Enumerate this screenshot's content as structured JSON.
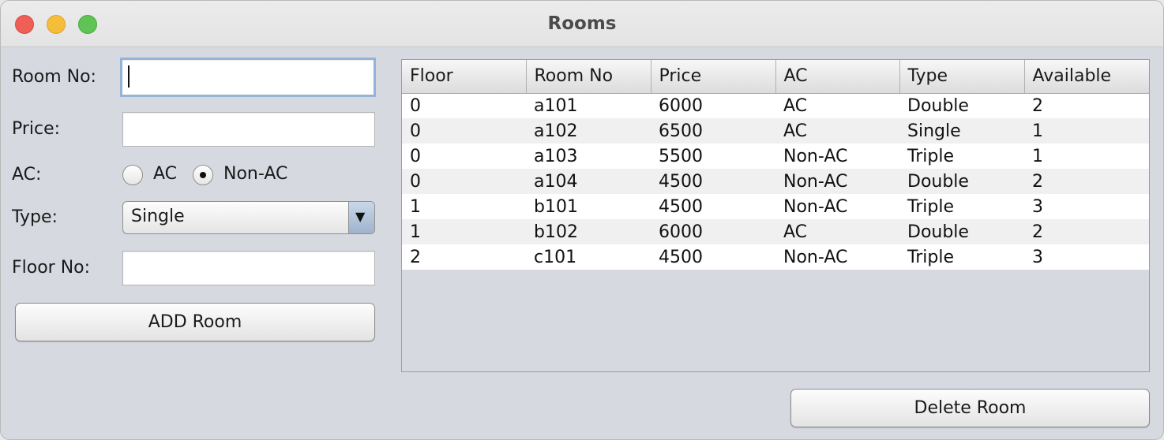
{
  "window": {
    "title": "Rooms"
  },
  "form": {
    "room_no_label": "Room No:",
    "room_no_value": "",
    "price_label": "Price:",
    "price_value": "",
    "ac_label": "AC:",
    "ac_options": [
      "AC",
      "Non-AC"
    ],
    "ac_selected": "Non-AC",
    "type_label": "Type:",
    "type_selected": "Single",
    "floor_label": "Floor No:",
    "floor_value": "",
    "add_button": "ADD Room"
  },
  "table": {
    "columns": [
      "Floor",
      "Room No",
      "Price",
      "AC",
      "Type",
      "Available"
    ],
    "rows": [
      [
        "0",
        "a101",
        "6000",
        "AC",
        "Double",
        "2"
      ],
      [
        "0",
        "a102",
        "6500",
        "AC",
        "Single",
        "1"
      ],
      [
        "0",
        "a103",
        "5500",
        "Non-AC",
        "Triple",
        "1"
      ],
      [
        "0",
        "a104",
        "4500",
        "Non-AC",
        "Double",
        "2"
      ],
      [
        "1",
        "b101",
        "4500",
        "Non-AC",
        "Triple",
        "3"
      ],
      [
        "1",
        "b102",
        "6000",
        "AC",
        "Double",
        "2"
      ],
      [
        "2",
        "c101",
        "4500",
        "Non-AC",
        "Triple",
        "3"
      ]
    ]
  },
  "delete_button": "Delete Room",
  "colors": {
    "close": "#ee5f57",
    "minimize": "#f6bd3b",
    "maximize": "#5fc454",
    "focus_ring": "#93b4d8",
    "panel_background": "#d6d9e0"
  }
}
